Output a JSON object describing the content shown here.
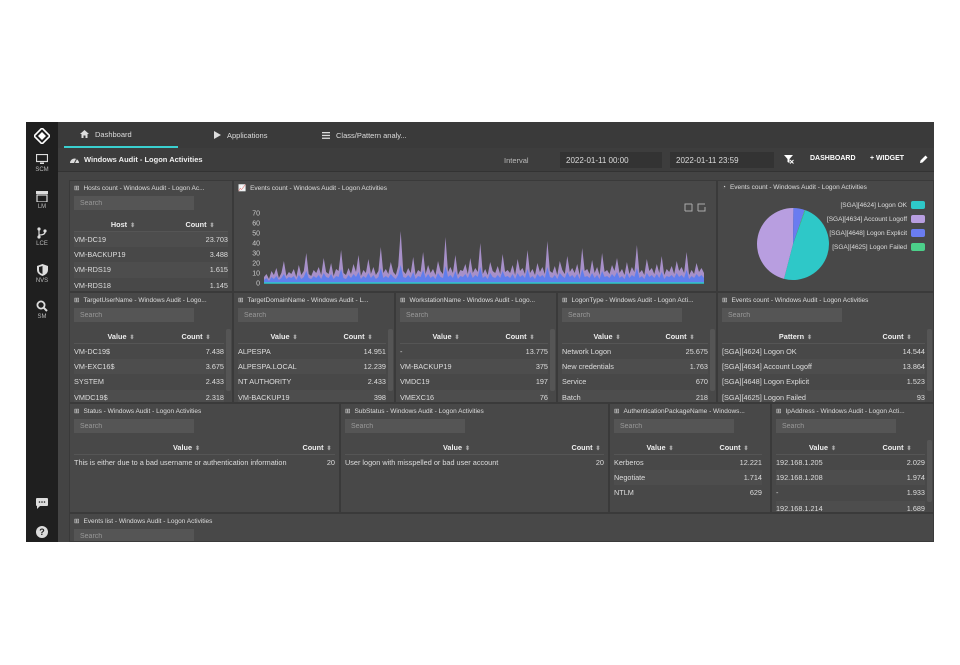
{
  "sidebar": {
    "items": [
      {
        "label": "SCM",
        "icon": "monitor-icon"
      },
      {
        "label": "LM",
        "icon": "archive-icon"
      },
      {
        "label": "LCE",
        "icon": "branch-icon"
      },
      {
        "label": "NVS",
        "icon": "shield-icon"
      },
      {
        "label": "SM",
        "icon": "search-icon"
      }
    ]
  },
  "tabs": [
    {
      "label": "Dashboard",
      "icon": "home-icon"
    },
    {
      "label": "Applications",
      "icon": "play-icon"
    },
    {
      "label": "Class/Pattern analy...",
      "icon": "list-icon"
    }
  ],
  "header": {
    "title": "Windows Audit - Logon Activities",
    "interval_label": "Interval",
    "date_from": "2022-01-11 00:00",
    "date_to": "2022-01-11 23:59",
    "dashboard_btn": "DASHBOARD",
    "widget_btn": "+ WIDGET"
  },
  "search_placeholder": "Search",
  "widgets": {
    "hosts": {
      "title": "Hosts count - Windows Audit - Logon Ac...",
      "col1": "Host",
      "col2": "Count",
      "rows": [
        [
          "VM-DC19",
          "23.703"
        ],
        [
          "VM-BACKUP19",
          "3.488"
        ],
        [
          "VM-RDS19",
          "1.615"
        ],
        [
          "VM-RDS18",
          "1.145"
        ]
      ]
    },
    "events_chart": {
      "title": "Events count - Windows Audit - Logon Activities"
    },
    "events_pie": {
      "title": "Events count - Windows Audit - Logon Activities",
      "legend": [
        {
          "label": "[SGA][4624] Logon OK",
          "color": "#2ec8c8"
        },
        {
          "label": "[SGA][4634] Account Logoff",
          "color": "#b89ee0"
        },
        {
          "label": "[SGA][4648] Logon Explicit",
          "color": "#6a7cf0"
        },
        {
          "label": "[SGA][4625] Logon Failed",
          "color": "#4cd08a"
        }
      ]
    },
    "target_user": {
      "title": "TargetUserName - Windows Audit - Logo...",
      "col1": "Value",
      "col2": "Count",
      "rows": [
        [
          "VM-DC19$",
          "7.438"
        ],
        [
          "VM-EXC16$",
          "3.675"
        ],
        [
          "SYSTEM",
          "2.433"
        ],
        [
          "VMDC19$",
          "2.318"
        ]
      ]
    },
    "target_domain": {
      "title": "TargetDomainName - Windows Audit - L...",
      "col1": "Value",
      "col2": "Count",
      "rows": [
        [
          "ALPESPA",
          "14.951"
        ],
        [
          "ALPESPA.LOCAL",
          "12.239"
        ],
        [
          "NT AUTHORITY",
          "2.433"
        ],
        [
          "VM-BACKUP19",
          "398"
        ]
      ]
    },
    "workstation": {
      "title": "WorkstationName - Windows Audit - Logo...",
      "col1": "Value",
      "col2": "Count",
      "rows": [
        [
          "-",
          "13.775"
        ],
        [
          "VM-BACKUP19",
          "375"
        ],
        [
          "VMDC19",
          "197"
        ],
        [
          "VMEXC16",
          "76"
        ]
      ]
    },
    "logon_type": {
      "title": "LogonType - Windows Audit - Logon Acti...",
      "col1": "Value",
      "col2": "Count",
      "rows": [
        [
          "Network Logon",
          "25.675"
        ],
        [
          "New credentials",
          "1.763"
        ],
        [
          "Service",
          "670"
        ],
        [
          "Batch",
          "218"
        ]
      ]
    },
    "events_pattern": {
      "title": "Events count - Windows Audit - Logon Activities",
      "col1": "Pattern",
      "col2": "Count",
      "rows": [
        [
          "[SGA][4624] Logon OK",
          "14.544"
        ],
        [
          "[SGA][4634] Account Logoff",
          "13.864"
        ],
        [
          "[SGA][4648] Logon Explicit",
          "1.523"
        ],
        [
          "[SGA][4625] Logon Failed",
          "93"
        ]
      ]
    },
    "status": {
      "title": "Status - Windows Audit - Logon Activities",
      "col1": "Value",
      "col2": "Count",
      "rows": [
        [
          "This is either due to a bad username or authentication information",
          "20"
        ]
      ]
    },
    "substatus": {
      "title": "SubStatus - Windows Audit - Logon Activities",
      "col1": "Value",
      "col2": "Count",
      "rows": [
        [
          "User logon with misspelled or bad user account",
          "20"
        ]
      ]
    },
    "auth_package": {
      "title": "AuthenticationPackageName - Windows...",
      "col1": "Value",
      "col2": "Count",
      "rows": [
        [
          "Kerberos",
          "12.221"
        ],
        [
          "Negotiate",
          "1.714"
        ],
        [
          "NTLM",
          "629"
        ]
      ]
    },
    "ip_address": {
      "title": "IpAddress - Windows Audit - Logon Acti...",
      "col1": "Value",
      "col2": "Count",
      "rows": [
        [
          "192.168.1.205",
          "2.029"
        ],
        [
          "192.168.1.208",
          "1.974"
        ],
        [
          "-",
          "1.933"
        ],
        [
          "192.168.1.214",
          "1.689"
        ]
      ]
    },
    "events_list": {
      "title": "Events list - Windows Audit - Logon Activities"
    }
  },
  "colors": {
    "accent": "#3ad0d0",
    "series1": "#b89ee0",
    "series2": "#5a7cf0",
    "series3": "#2ec8c8"
  },
  "chart_data": [
    {
      "type": "area",
      "title": "Events count - Windows Audit - Logon Activities",
      "ylim": [
        0,
        70
      ],
      "yticks": [
        0,
        10,
        20,
        30,
        40,
        50,
        60,
        70
      ],
      "grid": false,
      "series": [
        {
          "values": [
            6,
            9,
            4,
            12,
            8,
            15,
            5,
            10,
            22,
            7,
            11,
            9,
            14,
            6,
            18,
            8,
            12,
            30,
            9,
            7,
            13,
            10,
            16,
            8,
            25,
            11,
            9,
            20,
            7,
            14,
            12,
            33,
            10,
            8,
            15,
            9,
            19,
            11,
            28,
            7,
            13,
            10,
            24,
            9,
            16,
            8,
            12,
            36,
            10,
            14,
            9,
            21,
            11,
            8,
            17,
            52,
            12,
            9,
            15,
            10,
            26,
            8,
            13,
            11,
            31,
            9,
            18,
            10,
            14,
            8,
            22,
            12,
            9,
            46,
            11,
            16,
            10,
            28,
            8,
            13,
            12,
            19,
            9,
            25,
            10,
            15,
            11,
            40,
            9,
            14,
            8,
            21,
            12,
            10,
            17,
            9,
            29,
            11,
            13,
            10,
            18,
            8,
            24,
            12,
            15,
            9,
            33,
            10,
            14,
            8,
            20,
            11,
            16,
            9,
            42,
            12,
            10,
            17,
            8,
            22,
            13,
            9,
            27,
            11,
            15,
            10,
            19,
            8,
            35,
            12,
            14,
            9,
            23,
            10,
            16,
            8,
            30,
            11,
            13,
            9,
            18,
            12,
            25,
            10,
            14,
            8,
            21,
            9,
            16,
            11,
            38,
            10,
            13,
            8,
            24,
            12,
            15,
            9,
            19,
            10,
            27,
            8,
            14,
            11,
            17,
            9,
            22,
            12,
            16,
            10,
            31,
            8,
            13,
            9,
            20,
            11,
            15,
            10
          ]
        },
        {
          "values": [
            3,
            5,
            2,
            6,
            4,
            7,
            3,
            5,
            9,
            4,
            6,
            5,
            7,
            3,
            8,
            4,
            6,
            12,
            5,
            4,
            7,
            5,
            8,
            4,
            10,
            6,
            5,
            9,
            4,
            7,
            6,
            14,
            5,
            4,
            8,
            5,
            9,
            6,
            11,
            4,
            7,
            5,
            10,
            5,
            8,
            4,
            6,
            15,
            5,
            7,
            5,
            9,
            6,
            4,
            8,
            18,
            6,
            5,
            8,
            5,
            11,
            4,
            7,
            6,
            13,
            5,
            9,
            5,
            7,
            4,
            10,
            6,
            5,
            17,
            6,
            8,
            5,
            12,
            4,
            7,
            6,
            9,
            5,
            11,
            5,
            8,
            6,
            16,
            5,
            7,
            4,
            10,
            6,
            5,
            8,
            5,
            12,
            6,
            7,
            5,
            9,
            4,
            10,
            6,
            8,
            5,
            14,
            5,
            7,
            4,
            9,
            6,
            8,
            5,
            16,
            6,
            5,
            8,
            4,
            10,
            7,
            5,
            11,
            6,
            8,
            5,
            9,
            4,
            14,
            6,
            7,
            5,
            10,
            5,
            8,
            4,
            12,
            6,
            7,
            5,
            9,
            6,
            11,
            5,
            7,
            4,
            10,
            5,
            8,
            6,
            15,
            5,
            7,
            4,
            10,
            6,
            8,
            5,
            9,
            5,
            11,
            4,
            7,
            6,
            8,
            5,
            10,
            6,
            8,
            5,
            13,
            4,
            7,
            5,
            9,
            6,
            8,
            5
          ]
        }
      ]
    },
    {
      "type": "pie",
      "title": "Events count - Windows Audit - Logon Activities",
      "categories": [
        "[SGA][4624] Logon OK",
        "[SGA][4634] Account Logoff",
        "[SGA][4648] Logon Explicit",
        "[SGA][4625] Logon Failed"
      ],
      "values": [
        14544,
        13864,
        1523,
        93
      ],
      "legend": "right"
    }
  ]
}
